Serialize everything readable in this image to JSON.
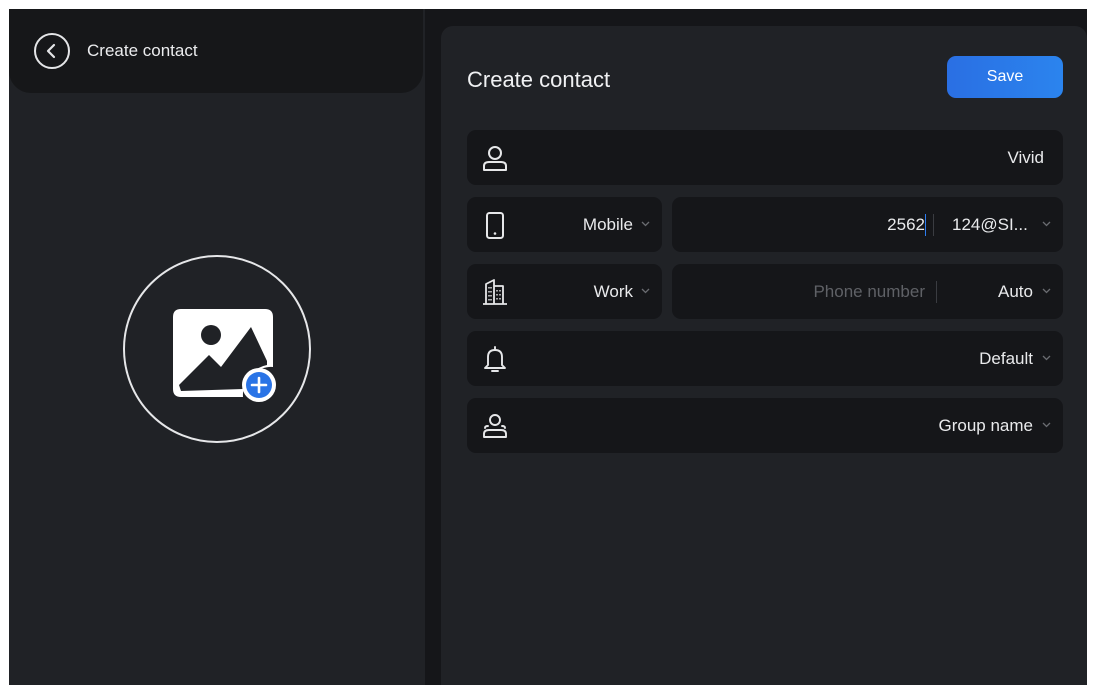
{
  "left": {
    "title": "Create contact",
    "back_icon": "chevron-left-icon",
    "avatar_icon": "add-photo-icon"
  },
  "form": {
    "title": "Create contact",
    "save_label": "Save",
    "name": {
      "icon": "person-icon",
      "value": "Vivid"
    },
    "phone1": {
      "icon": "mobile-phone-icon",
      "type": "Mobile",
      "number": "2562",
      "account": "124@SI..."
    },
    "phone2": {
      "icon": "building-icon",
      "type": "Work",
      "number_placeholder": "Phone number",
      "account": "Auto"
    },
    "ringtone": {
      "icon": "bell-icon",
      "value": "Default"
    },
    "group": {
      "icon": "group-icon",
      "value": "Group name"
    }
  },
  "colors": {
    "accent": "#2b7bea",
    "panel_bg": "#202226",
    "field_bg": "#151619",
    "text": "#e9eaec",
    "placeholder": "#5f6166"
  }
}
